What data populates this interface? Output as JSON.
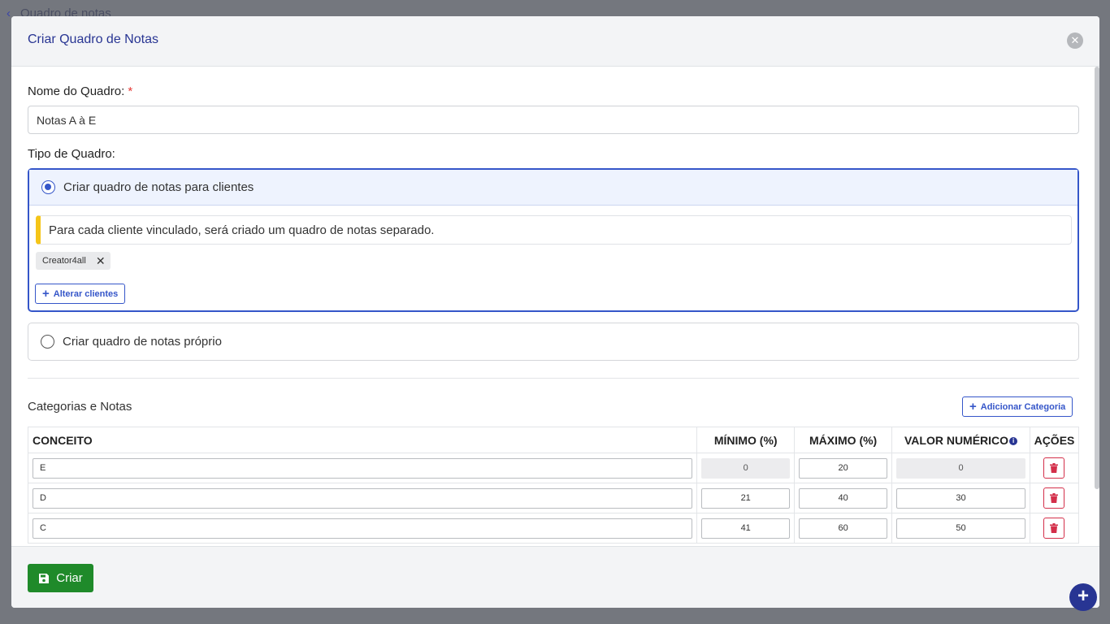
{
  "background": {
    "page_title": "Quadro de notas"
  },
  "modal": {
    "title": "Criar Quadro de Notas",
    "close_icon": "close-icon"
  },
  "form": {
    "name_label": "Nome do Quadro:",
    "required_mark": "*",
    "name_value": "Notas A à E",
    "type_label": "Tipo de Quadro:",
    "option_clients": {
      "label": "Criar quadro de notas para clientes",
      "selected": true,
      "info": "Para cada cliente vinculado, será criado um quadro de notas separado.",
      "chips": [
        "Creator4all"
      ],
      "change_button": "Alterar clientes"
    },
    "option_own": {
      "label": "Criar quadro de notas próprio",
      "selected": false
    }
  },
  "categories": {
    "title": "Categorias e Notas",
    "add_button": "Adicionar Categoria",
    "headers": {
      "concept": "CONCEITO",
      "min": "MÍNIMO (%)",
      "max": "MÁXIMO (%)",
      "numeric": "VALOR NUMÉRICO",
      "actions": "AÇÕES"
    },
    "rows": [
      {
        "concept": "E",
        "min": "0",
        "max": "20",
        "numeric": "0",
        "min_disabled": true,
        "numeric_disabled": true
      },
      {
        "concept": "D",
        "min": "21",
        "max": "40",
        "numeric": "30",
        "min_disabled": false,
        "numeric_disabled": false
      },
      {
        "concept": "C",
        "min": "41",
        "max": "60",
        "numeric": "50",
        "min_disabled": false,
        "numeric_disabled": false
      }
    ]
  },
  "footer": {
    "create_button": "Criar"
  },
  "colors": {
    "primary": "#283593",
    "accent_blue": "#3556c9",
    "success": "#1f8a2a",
    "danger": "#d32f4a",
    "warning": "#f5c518"
  }
}
